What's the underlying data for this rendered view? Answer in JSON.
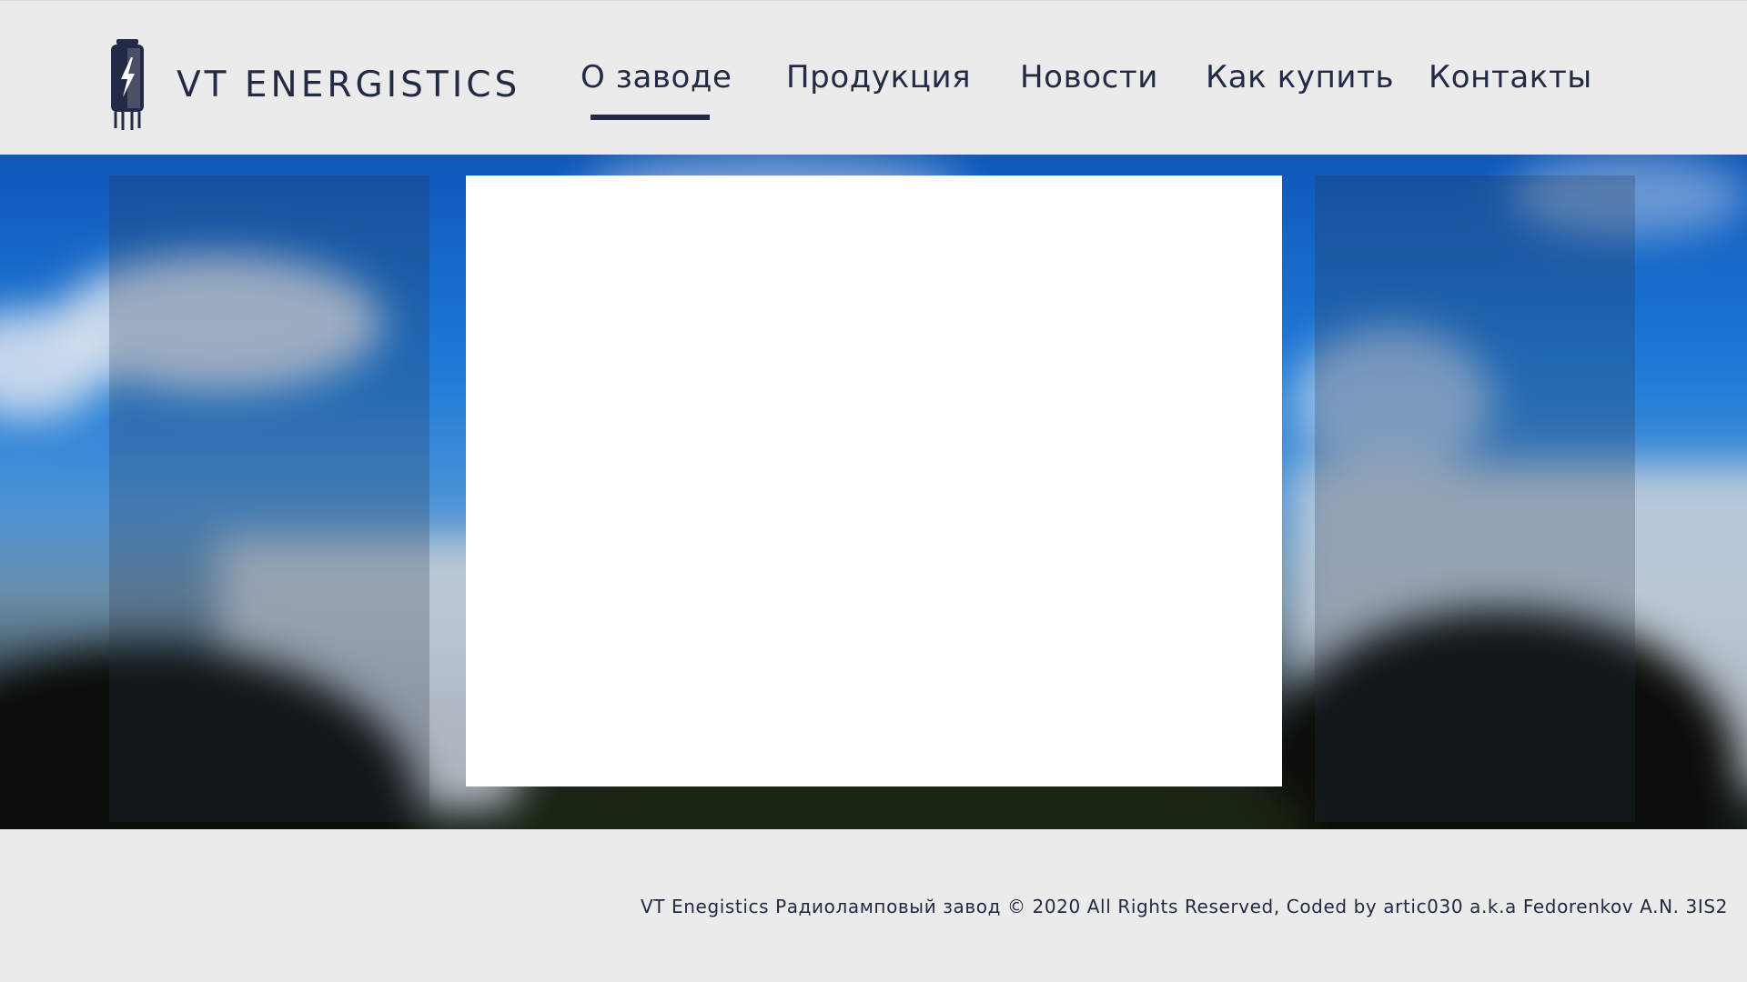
{
  "header": {
    "logo_text": "VT ENERGISTICS",
    "icon": "vacuum-tube-lightning-icon"
  },
  "nav": {
    "items": [
      {
        "label": "О заводе",
        "active": true
      },
      {
        "label": "Продукция",
        "active": false
      },
      {
        "label": "Новости",
        "active": false
      },
      {
        "label": "Как купить",
        "active": false
      },
      {
        "label": "Контакты",
        "active": false
      }
    ]
  },
  "footer": {
    "text": "VT Enegistics Радиоламповый завод © 2020 All Rights Reserved, Coded by artic030 a.k.a Fedorenkov A.N. 3IS2"
  },
  "colors": {
    "page_background": "#ebebeb",
    "text": "#232a45",
    "accent": "#232a45",
    "center_panel": "#ffffff"
  }
}
